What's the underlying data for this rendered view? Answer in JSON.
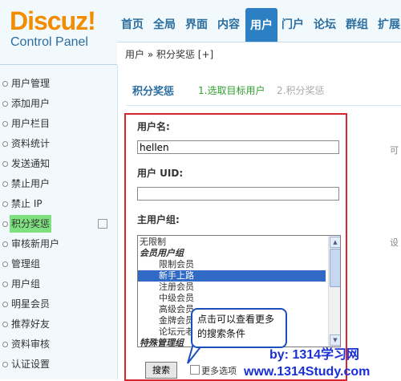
{
  "logo": {
    "brand": "Discuz!",
    "subtitle": "Control Panel"
  },
  "nav": {
    "items": [
      {
        "label": "首页",
        "active": false
      },
      {
        "label": "全局",
        "active": false
      },
      {
        "label": "界面",
        "active": false
      },
      {
        "label": "内容",
        "active": false
      },
      {
        "label": "用户",
        "active": true
      },
      {
        "label": "门户",
        "active": false
      },
      {
        "label": "论坛",
        "active": false
      },
      {
        "label": "群组",
        "active": false
      },
      {
        "label": "扩展",
        "active": false
      }
    ]
  },
  "breadcrumb": {
    "text": "用户 » 积分奖惩   [+]"
  },
  "sidebar": {
    "items": [
      {
        "label": "用户管理"
      },
      {
        "label": "添加用户"
      },
      {
        "label": "用户栏目"
      },
      {
        "label": "资料统计"
      },
      {
        "label": "发送通知"
      },
      {
        "label": "禁止用户"
      },
      {
        "label": "禁止 IP"
      },
      {
        "label": "积分奖惩",
        "active": true
      },
      {
        "label": "审核新用户"
      },
      {
        "label": "管理组"
      },
      {
        "label": "用户组"
      },
      {
        "label": "明星会员"
      },
      {
        "label": "推荐好友"
      },
      {
        "label": "资料审核"
      },
      {
        "label": "认证设置"
      }
    ]
  },
  "steps": {
    "title": "积分奖惩",
    "step1": "1.选取目标用户",
    "step2": "2.积分奖惩"
  },
  "form": {
    "username_label": "用户名:",
    "username_value": "hellen",
    "uid_label": "用户  UID:",
    "uid_value": "",
    "group_label": "主用户组:",
    "group_options": [
      {
        "label": "无限制",
        "indent": 0,
        "group": false,
        "selected": false
      },
      {
        "label": "会员用户组",
        "indent": 0,
        "group": true,
        "selected": false
      },
      {
        "label": "限制会员",
        "indent": 1,
        "group": false,
        "selected": false
      },
      {
        "label": "新手上路",
        "indent": 1,
        "group": false,
        "selected": true
      },
      {
        "label": "注册会员",
        "indent": 1,
        "group": false,
        "selected": false
      },
      {
        "label": "中级会员",
        "indent": 1,
        "group": false,
        "selected": false
      },
      {
        "label": "高级会员",
        "indent": 1,
        "group": false,
        "selected": false
      },
      {
        "label": "金牌会员",
        "indent": 1,
        "group": false,
        "selected": false
      },
      {
        "label": "论坛元老",
        "indent": 1,
        "group": false,
        "selected": false
      },
      {
        "label": "特殊管理组",
        "indent": 0,
        "group": true,
        "selected": false
      }
    ],
    "search_button": "搜索",
    "more_options_label": "更多选项",
    "hint_right_1": "可",
    "hint_right_2": "设"
  },
  "callout": {
    "text": "点击可以查看更多的搜索条件"
  },
  "watermark": {
    "line1": "by: 1314学习网",
    "line2": "www.1314Study.com"
  },
  "colors": {
    "accent": "#2b7fc2",
    "highlight_border": "#d9252b",
    "callout_border": "#1b4fbc",
    "watermark": "#1a2fd6"
  }
}
